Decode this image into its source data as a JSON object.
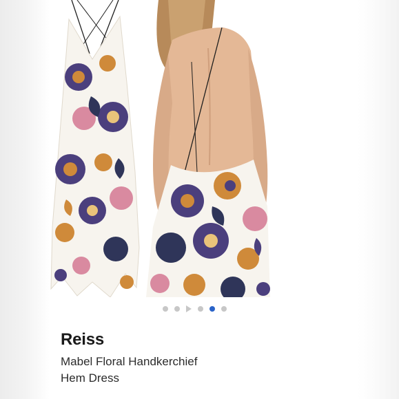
{
  "product": {
    "brand": "Reiss",
    "title": "Mabel Floral Handkerchief Hem Dress"
  },
  "gallery": {
    "images": [
      "dress-front-image",
      "model-back-view-image"
    ],
    "carousel_items": [
      "dot",
      "dot",
      "video",
      "dot",
      "dot",
      "dot"
    ],
    "active_index": 4,
    "colors": {
      "active_dot": "#2a63c8",
      "inactive_dot": "#c7c7c7",
      "fabric_base": "#f7f4ee",
      "print_purple": "#4b3f7d",
      "print_orange": "#cf8a3a",
      "print_pink": "#d98aa0",
      "print_navy": "#2f3559"
    }
  }
}
